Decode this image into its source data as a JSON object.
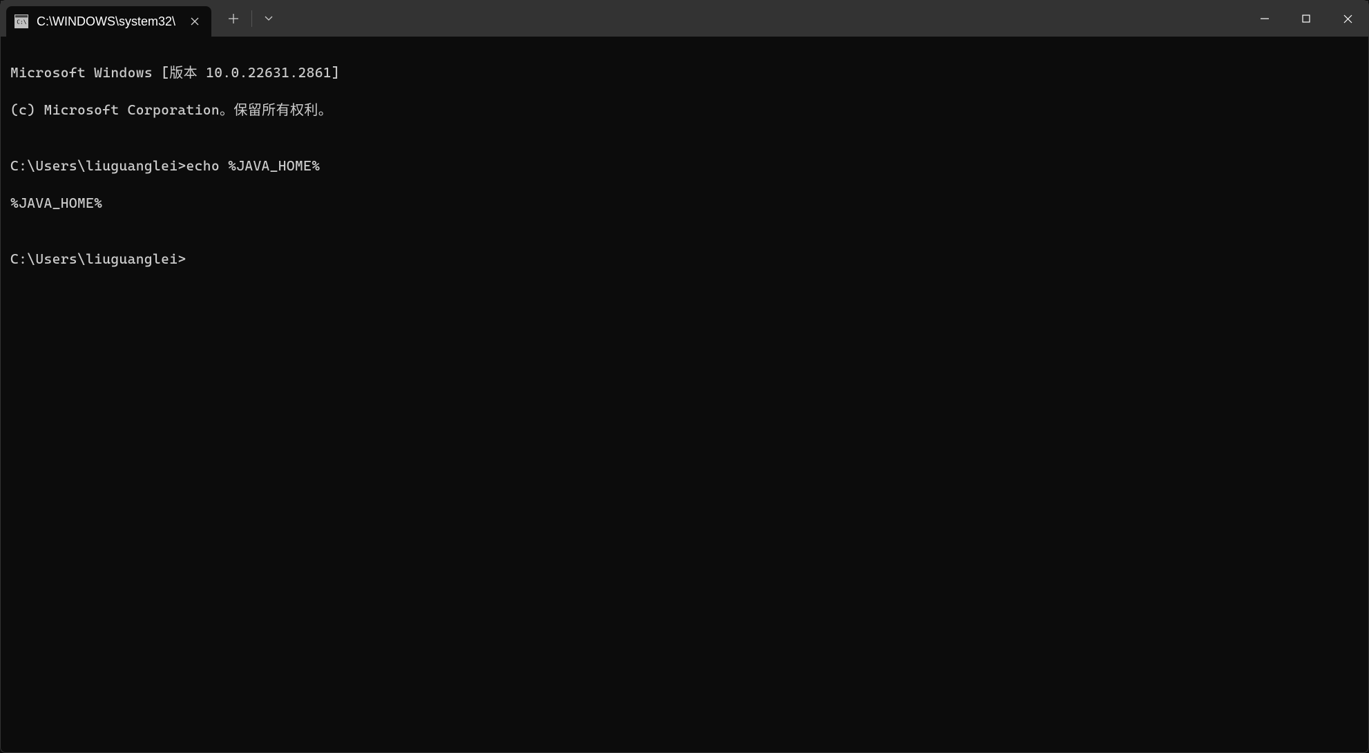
{
  "tab": {
    "title": "C:\\WINDOWS\\system32\\"
  },
  "terminal": {
    "line1": "Microsoft Windows [版本 10.0.22631.2861]",
    "line2": "(c) Microsoft Corporation。保留所有权利。",
    "line3": "",
    "line4": "C:\\Users\\liuguanglei>echo %JAVA_HOME%",
    "line5": "%JAVA_HOME%",
    "line6": "",
    "line7": "C:\\Users\\liuguanglei>"
  }
}
